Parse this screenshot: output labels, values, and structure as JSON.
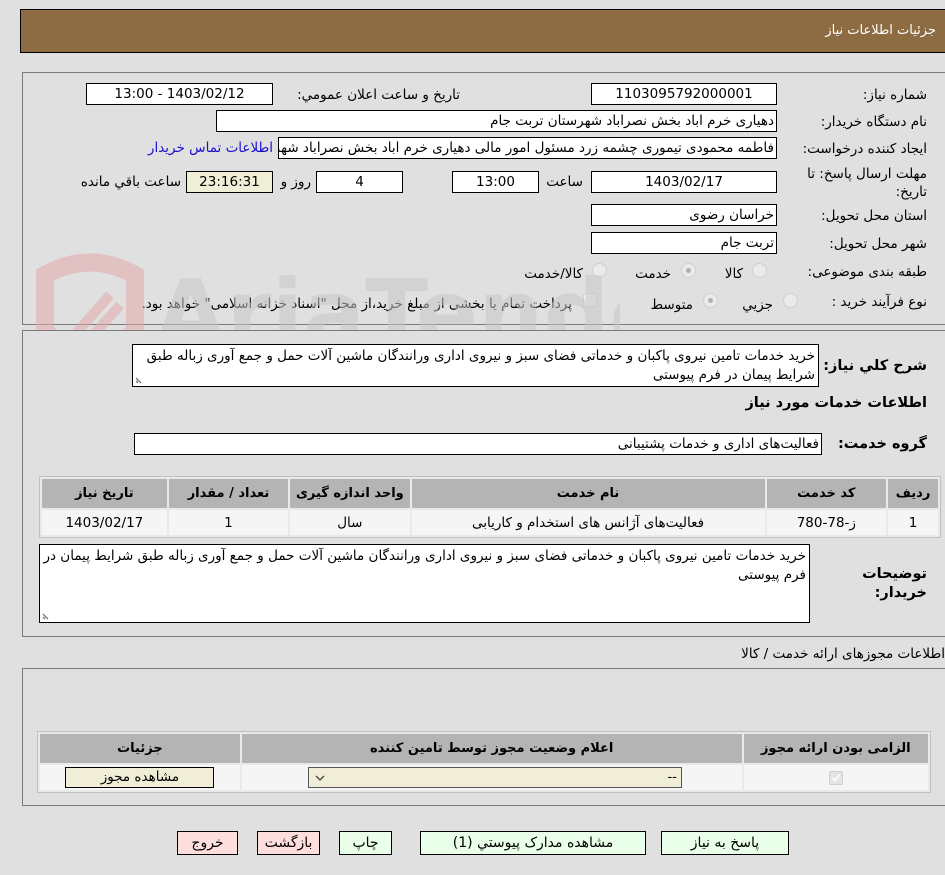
{
  "header": {
    "title": "جزئیات اطلاعات نیاز"
  },
  "details": {
    "need_number": {
      "label": "شماره نیاز:",
      "value": "1103095792000001"
    },
    "announce_datetime": {
      "label": "تاریخ و ساعت اعلان عمومي:",
      "value": "1403/02/12 - 13:00"
    },
    "buyer_org": {
      "label": "نام دستگاه خريدار:",
      "value": "دهیاری خرم اباد بخش نصراباد شهرستان تربت جام"
    },
    "requester": {
      "label": "ایجاد کننده درخواست:",
      "value": "فاطمه محمودی تیموری چشمه زرد مسئول امور مالی دهیاری خرم اباد بخش نصراباد شهرستان تربت جام",
      "contact_link": "اطلاعات تماس خریدار"
    },
    "deadline": {
      "label": "مهلت ارسال پاسخ: تا تاریخ:",
      "date": "1403/02/17",
      "time_label": "ساعت",
      "time": "13:00",
      "days": "4",
      "days_label": "روز و",
      "remaining": "23:16:31",
      "remaining_label": "ساعت باقي مانده"
    },
    "province": {
      "label": "استان محل تحویل:",
      "value": "خراسان رضوی"
    },
    "city": {
      "label": "شهر محل تحویل:",
      "value": "تربت جام"
    },
    "category": {
      "label": "طبقه بندی موضوعی:",
      "options": [
        "کالا",
        "خدمت",
        "کالا/خدمت"
      ],
      "selected": "خدمت"
    },
    "process": {
      "label": "نوع فرآیند خرید :",
      "options": [
        "جزيي",
        "متوسط"
      ],
      "selected": "متوسط",
      "treasury_note": "پرداخت تمام یا بخشی از مبلغ خرید،از محل \"اسناد خزانه اسلامی\" خواهد بود.",
      "treasury_checked": false
    }
  },
  "description": {
    "label": "شرح کلي نياز:",
    "value": "خرید خدمات تامین نیروی پاکبان و خدماتی فضای سبز و نیروی اداری ورانندگان ماشین آلات حمل و جمع آوری زباله طبق شرایط پیمان در فرم پیوستی"
  },
  "services": {
    "title": "اطلاعات خدمات مورد نیاز",
    "group_label": "گروه خدمت:",
    "group_value": "فعالیت‌های اداری و خدمات پشتیبانی",
    "columns": [
      "ردیف",
      "کد خدمت",
      "نام خدمت",
      "واحد اندازه گیری",
      "تعداد / مقدار",
      "تاریخ نیاز"
    ],
    "rows": [
      [
        "1",
        "ز-78-780",
        "فعالیت‌های آژانس های استخدام و کاریابی",
        "سال",
        "1",
        "1403/02/17"
      ]
    ]
  },
  "buyer_notes": {
    "label": "توضیحات خریدار:",
    "value": "خرید خدمات تامین نیروی پاکبان و خدماتی فضای سبز و نیروی اداری ورانندگان ماشین آلات حمل و جمع آوری زباله طبق شرایط پیمان در فرم پیوستی"
  },
  "permits": {
    "title": "اطلاعات مجوزهای ارائه خدمت / کالا",
    "columns": [
      "الزامی بودن ارائه مجوز",
      "اعلام وضعیت مجوز توسط تامین کننده",
      "جزئیات"
    ],
    "row": {
      "required_checked": true,
      "status_value": "--",
      "details_button": "مشاهده مجوز"
    }
  },
  "actions": {
    "respond": "پاسخ به نیاز",
    "attachments": "مشاهده مدارک پیوستي (1)",
    "print": "چاپ",
    "back": "بازگشت",
    "exit": "خروج"
  },
  "watermark": {
    "text": "AriaTender.neT"
  }
}
